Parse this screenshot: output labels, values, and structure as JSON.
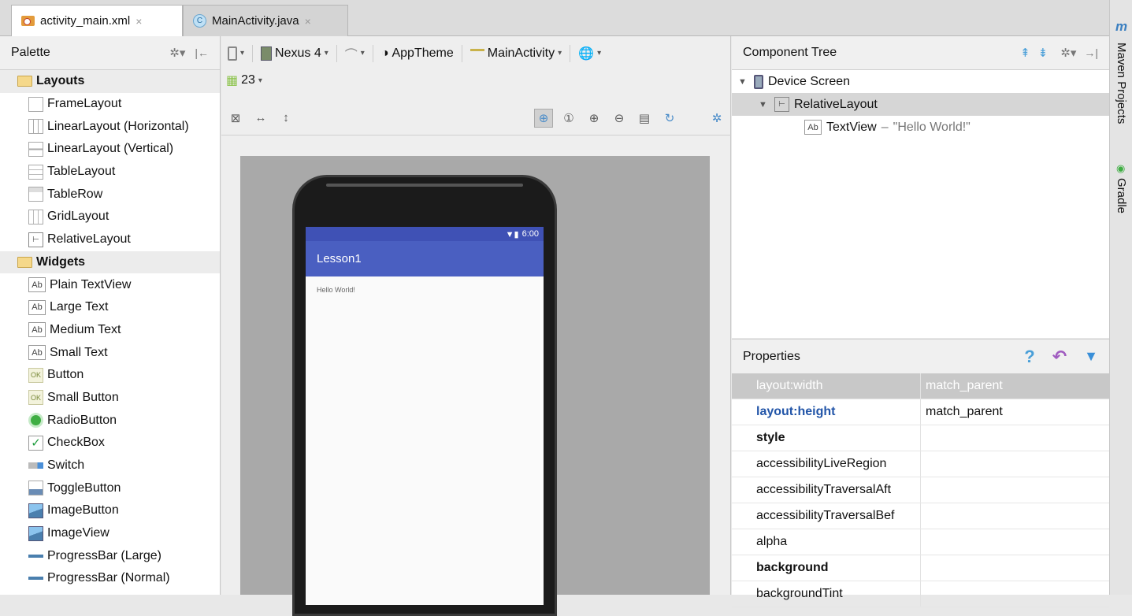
{
  "tabs": [
    {
      "label": "activity_main.xml",
      "close": "×",
      "icon": "xml-file-icon"
    },
    {
      "label": "MainActivity.java",
      "close": "×",
      "icon": "java-class-icon"
    }
  ],
  "palette": {
    "title": "Palette",
    "categories": [
      {
        "label": "Layouts",
        "items": [
          "FrameLayout",
          "LinearLayout (Horizontal)",
          "LinearLayout (Vertical)",
          "TableLayout",
          "TableRow",
          "GridLayout",
          "RelativeLayout"
        ]
      },
      {
        "label": "Widgets",
        "items": [
          "Plain TextView",
          "Large Text",
          "Medium Text",
          "Small Text",
          "Button",
          "Small Button",
          "RadioButton",
          "CheckBox",
          "Switch",
          "ToggleButton",
          "ImageButton",
          "ImageView",
          "ProgressBar (Large)",
          "ProgressBar (Normal)"
        ]
      }
    ],
    "ab_glyph": "Ab",
    "ok_glyph": "OK"
  },
  "toolbar": {
    "device": "Nexus 4",
    "theme": "AppTheme",
    "activity": "MainActivity",
    "api": "23"
  },
  "phone": {
    "time": "6:00",
    "app_title": "Lesson1",
    "content_text": "Hello World!"
  },
  "component_tree": {
    "title": "Component Tree",
    "device": "Device Screen",
    "layout": "RelativeLayout",
    "view": "TextView",
    "separator": "–",
    "view_text": "\"Hello World!\""
  },
  "properties": {
    "title": "Properties",
    "help": "?",
    "rows": [
      {
        "key": "layout:width",
        "value": "match_parent"
      },
      {
        "key": "layout:height",
        "value": "match_parent"
      },
      {
        "key": "style",
        "value": ""
      },
      {
        "key": "accessibilityLiveRegion",
        "value": ""
      },
      {
        "key": "accessibilityTraversalAft",
        "value": ""
      },
      {
        "key": "accessibilityTraversalBef",
        "value": ""
      },
      {
        "key": "alpha",
        "value": ""
      },
      {
        "key": "background",
        "value": ""
      },
      {
        "key": "backgroundTint",
        "value": ""
      }
    ]
  },
  "side_tools": {
    "m_glyph": "m",
    "maven": "Maven Projects",
    "gradle": "Gradle"
  },
  "colors": {
    "app_bar": "#4a5fc1",
    "status_bar": "#3f51b5",
    "selected_property": "#c8c8c8",
    "link_blue": "#2255a8"
  }
}
